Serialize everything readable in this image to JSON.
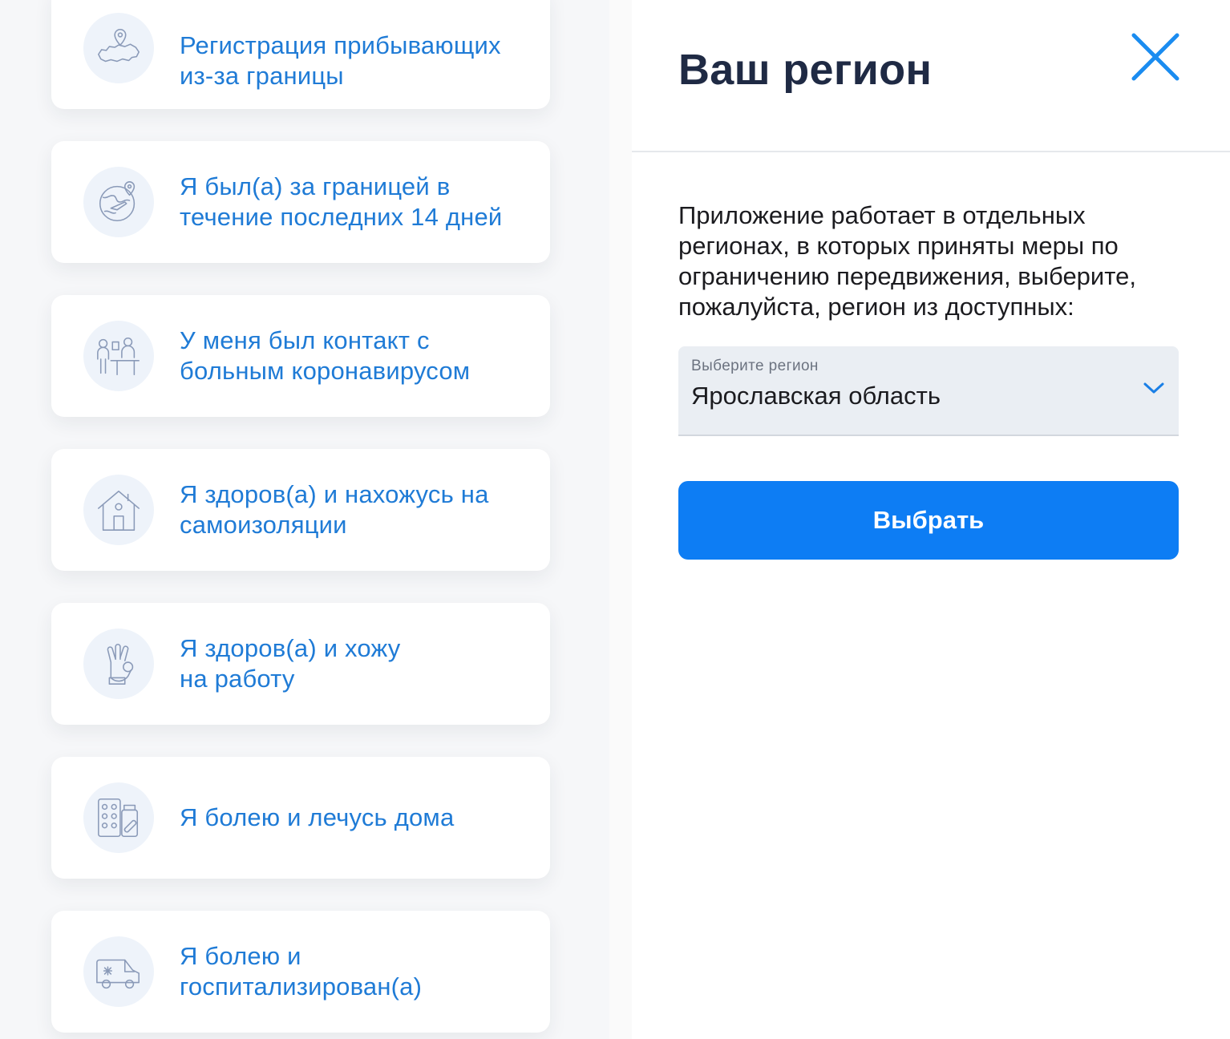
{
  "options": [
    {
      "label": "Регистрация прибывающих\nиз-за границы",
      "icon": "russia-map-pin-icon"
    },
    {
      "label": "Я был(а) за границей в\nтечение последних 14 дней",
      "icon": "globe-plane-icon"
    },
    {
      "label": "У меня был контакт с\nбольным коронавирусом",
      "icon": "people-contact-icon"
    },
    {
      "label": "Я здоров(а) и нахожусь на\nсамоизоляции",
      "icon": "house-icon"
    },
    {
      "label": "Я здоров(а) и хожу\nна работу",
      "icon": "ok-hand-icon"
    },
    {
      "label": "Я болею и лечусь дома",
      "icon": "pills-icon"
    },
    {
      "label": "Я болею и\nгоспитализирован(а)",
      "icon": "ambulance-icon"
    }
  ],
  "modal": {
    "title": "Ваш регион",
    "description": "Приложение работает в отдельных регионах, в которых приняты меры по ограничению передвижения, выберите, пожалуйста, регион из доступных:",
    "select": {
      "caption": "Выберите регион",
      "value": "Ярославская область"
    },
    "submit_label": "Выбрать"
  },
  "colors": {
    "accent": "#0d7df4",
    "link_text": "#1f7bd6",
    "title": "#1f2a44",
    "icon_stroke": "#8a9ab8",
    "close_icon": "#1a8cf0"
  }
}
